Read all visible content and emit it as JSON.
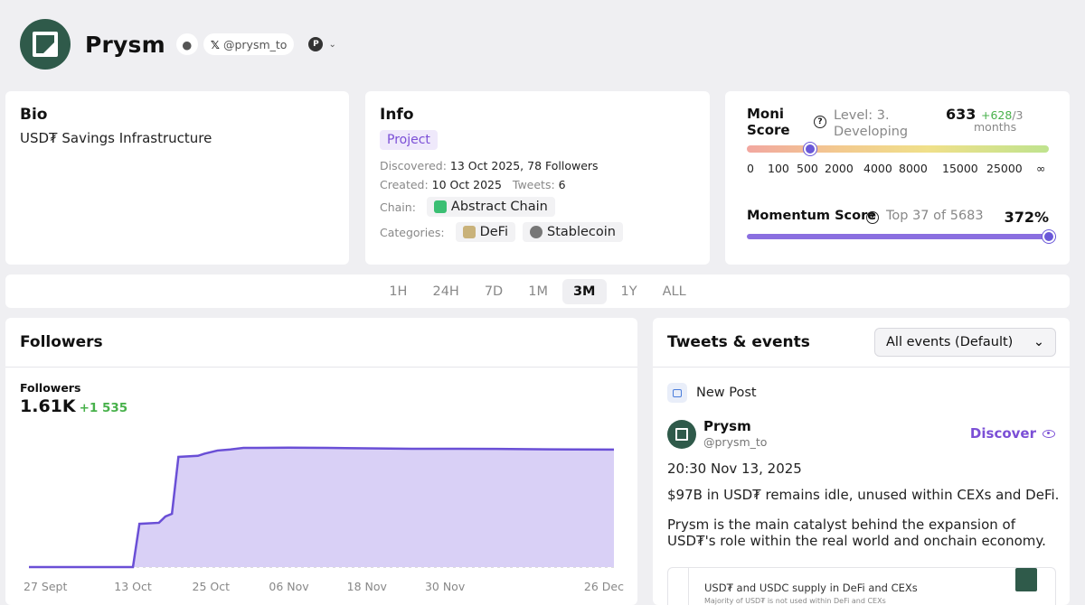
{
  "profile": {
    "name": "Prysm",
    "handle": "@prysm_to",
    "x_glyph": "𝕏"
  },
  "bio": {
    "title": "Bio",
    "text": "USD₮ Savings Infrastructure"
  },
  "info": {
    "title": "Info",
    "tag": "Project",
    "discovered_label": "Discovered:",
    "discovered_value": "13 Oct 2025, 78 Followers",
    "created_label": "Created:",
    "created_value": "10 Oct 2025",
    "tweets_label": "Tweets:",
    "tweets_value": "6",
    "chain_label": "Chain:",
    "chain_value": "Abstract Chain",
    "categories_label": "Categories:",
    "categories": [
      "DeFi",
      "Stablecoin"
    ]
  },
  "moni": {
    "title": "Moni Score",
    "level": "Level: 3. Developing",
    "score": "633",
    "delta": "+628",
    "per": "/3",
    "months": "months",
    "ticks": [
      "0",
      "100",
      "500",
      "2000",
      "4000",
      "8000",
      "15000",
      "25000",
      "∞"
    ],
    "momentum_title": "Momentum Score",
    "momentum_rank": "Top 37 of 5683",
    "momentum_pct": "372%"
  },
  "timeframes": {
    "items": [
      "1H",
      "24H",
      "7D",
      "1M",
      "3M",
      "1Y",
      "ALL"
    ],
    "active": "3M"
  },
  "followers": {
    "title": "Followers",
    "label": "Followers",
    "value": "1.61K",
    "delta": "+1 535"
  },
  "chart_data": {
    "type": "area",
    "title": "",
    "xlabel": "",
    "ylabel": "",
    "x_ticks": [
      "27 Sept",
      "13 Oct",
      "25 Oct",
      "06 Nov",
      "18 Nov",
      "30 Nov",
      "26 Dec"
    ],
    "x": [
      "2025-09-27",
      "2025-10-05",
      "2025-10-12",
      "2025-10-13",
      "2025-10-14",
      "2025-10-17",
      "2025-10-18",
      "2025-10-19",
      "2025-10-20",
      "2025-10-23",
      "2025-10-24",
      "2025-10-25",
      "2025-10-26",
      "2025-10-28",
      "2025-10-30",
      "2025-11-01",
      "2025-11-06",
      "2025-11-12",
      "2025-11-18",
      "2025-11-25",
      "2025-11-30",
      "2025-12-08",
      "2025-12-16",
      "2025-12-26"
    ],
    "values": [
      0,
      0,
      0,
      0,
      410,
      420,
      480,
      505,
      1045,
      1055,
      1075,
      1090,
      1105,
      1115,
      1130,
      1130,
      1132,
      1130,
      1126,
      1122,
      1122,
      1120,
      1116,
      1114
    ],
    "series_color": "#6a4fd6",
    "fill_color": "#d9d0f6"
  },
  "tweets": {
    "title": "Tweets & events",
    "filter": "All events (Default)",
    "new_post_label": "New Post",
    "author": "Prysm",
    "author_handle": "@prysm_to",
    "discover": "Discover",
    "date": "20:30 Nov 13, 2025",
    "line1": "$97B in USD₮ remains idle, unused within CEXs and DeFi.",
    "line2": "Prysm is the main catalyst behind the expansion of USD₮'s role within the real world and onchain economy.",
    "embed_title": "USD₮ and USDC supply in DeFi and CEXs",
    "embed_sub": "Majority of USD₮ is not used within DeFi and CEXs"
  }
}
